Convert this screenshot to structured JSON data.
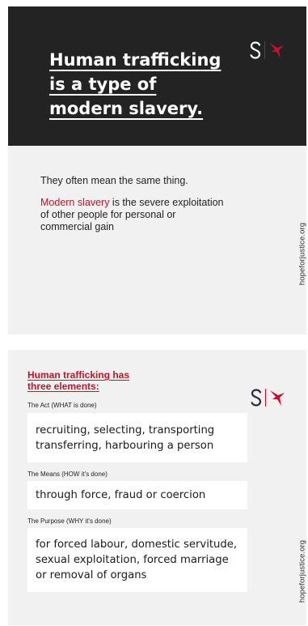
{
  "card1": {
    "title": "Human trafficking is a type of modern slavery.",
    "line1": "They often mean the same thing.",
    "highlight": "Modern slavery",
    "line2_rest": " is the severe exploitation of other people for personal or commercial gain",
    "vertical_text": "hopeforjustice.org"
  },
  "card2": {
    "title": "Human trafficking has three elements:",
    "elements": [
      {
        "label": "The Act (WHAT is done)",
        "text": "recruiting, selecting, transporting transferring, harbouring a person"
      },
      {
        "label": "The Means (HOW it's done)",
        "text": "through force, fraud or coercion"
      },
      {
        "label": "The Purpose (WHY it's done)",
        "text": "for forced labour, domestic servitude, sexual exploitation, forced marriage or removal of organs"
      }
    ],
    "vertical_text": "hopeforjustice.org"
  },
  "brand": {
    "red": "#c8102e",
    "dark": "#232323",
    "logo_icon": "s-bird-logo-icon"
  }
}
